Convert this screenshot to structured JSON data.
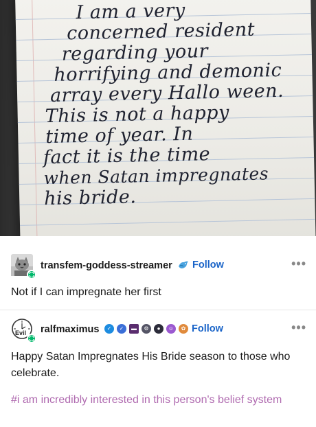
{
  "note": {
    "lines": [
      "I am a very",
      "concerned resident",
      "regarding your",
      "horrifying and demonic",
      "array every Hallo ween.",
      "This is not a happy",
      "time of year. In",
      "fact it is the time",
      "when Satan impregnates",
      "his bride."
    ]
  },
  "reply1": {
    "username": "transfem-goddess-streamer",
    "follow_label": "Follow",
    "more_label": "•••",
    "text": "Not if I can impregnate her first",
    "avatar_icon": "gray-cat-avatar-icon",
    "badge_icon": "reblog-badge-icon",
    "blog_badge_icon": "blue-bird-badge-icon"
  },
  "reply2": {
    "username": "ralfmaximus",
    "follow_label": "Follow",
    "more_label": "•••",
    "text": "Happy Satan Impregnates His Bride season to those who celebrate.",
    "tags": "#i am incredibly interested in this person's belief system",
    "avatar_icon": "evil-clock-avatar-icon",
    "avatar_text": "Evil",
    "badge_icon": "reblog-badge-icon",
    "badge_icons": [
      "blue-check-badge-icon",
      "blue-check-badge-icon",
      "typewriter-badge-icon",
      "gear-badge-icon",
      "ghost-badge-icon",
      "purple-face-badge-icon",
      "flower-badge-icon"
    ]
  },
  "colors": {
    "follow": "#1a64c8",
    "tags": "#b06bb0",
    "badge_green": "#00b86b"
  }
}
